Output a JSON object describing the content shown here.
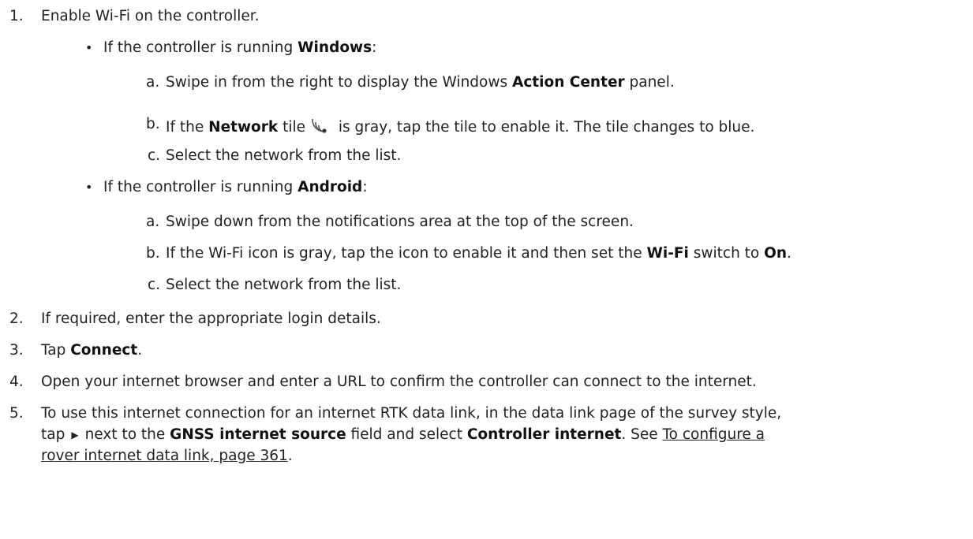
{
  "steps": [
    {
      "num": "1.",
      "text": "Enable Wi-Fi on the controller.",
      "bullets": [
        {
          "pre": "If the controller is running ",
          "bold": "Windows",
          "post": ":",
          "substeps": [
            {
              "letter": "a.",
              "pre": "Swipe in from the right to display the Windows ",
              "bold": "Action Center",
              "post": " panel."
            },
            {
              "letter": "b.",
              "pre": "If the ",
              "bold": "Network",
              "mid": " tile",
              "icon": "wifi-network-icon",
              "post": " is gray, tap the tile to enable it. The tile changes to blue."
            },
            {
              "letter": "c.",
              "text": "Select the network from the list."
            }
          ]
        },
        {
          "pre": "If the controller is running ",
          "bold": "Android",
          "post": ":",
          "substeps": [
            {
              "letter": "a.",
              "text": "Swipe down from the notifications area at the top of the screen."
            },
            {
              "letter": "b.",
              "pre": "If the Wi-Fi icon is gray, tap the icon to enable it and then set the ",
              "bold": "Wi-Fi",
              "mid": " switch to ",
              "bold2": "On",
              "post": "."
            },
            {
              "letter": "c.",
              "text": "Select the network from the list."
            }
          ]
        }
      ]
    },
    {
      "num": "2.",
      "text": "If required, enter the appropriate login details."
    },
    {
      "num": "3.",
      "pre": "Tap ",
      "bold": "Connect",
      "post": "."
    },
    {
      "num": "4.",
      "text": "Open your internet browser and enter a URL to confirm the controller can connect to the internet."
    },
    {
      "num": "5.",
      "line1": "To use this internet connection for an internet RTK data link, in the data link page of the survey style,",
      "line2_pre": "tap",
      "line2_icon": "triangle-right-icon",
      "line2_mid": "next to the ",
      "line2_bold": "GNSS internet source",
      "line2_mid2": " field and select ",
      "line2_bold2": "Controller internet",
      "line2_post": ". See ",
      "link_part1": "To configure a",
      "link_part2": "rover internet data link, page 361",
      "line3_post": "."
    }
  ]
}
